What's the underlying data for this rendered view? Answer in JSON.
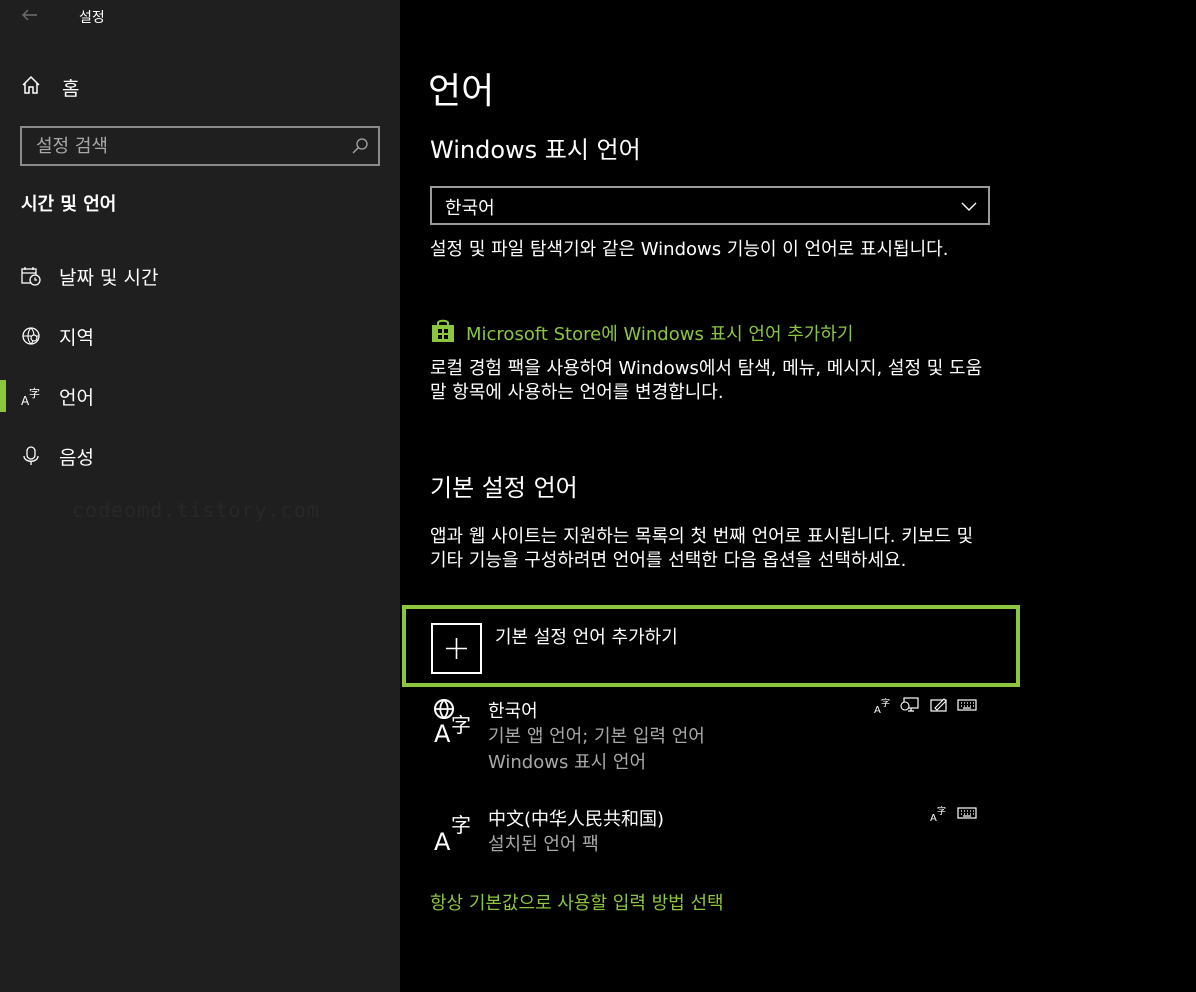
{
  "titlebar": {
    "app_title": "설정"
  },
  "sidebar": {
    "home_label": "홈",
    "search_placeholder": "설정 검색",
    "section_title": "시간 및 언어",
    "items": [
      {
        "label": "날짜 및 시간",
        "icon": "calendar-clock-icon"
      },
      {
        "label": "지역",
        "icon": "globe-region-icon"
      },
      {
        "label": "언어",
        "icon": "language-icon",
        "active": true
      },
      {
        "label": "음성",
        "icon": "microphone-icon"
      }
    ],
    "watermark": "codeomd.tistory.com"
  },
  "main": {
    "title": "언어",
    "display_lang": {
      "heading": "Windows 표시 언어",
      "selected": "한국어",
      "description": "설정 및 파일 탐색기와 같은 Windows 기능이 이 언어로 표시됩니다.",
      "store_link": "Microsoft Store에 Windows 표시 언어 추가하기",
      "store_desc": "로컬 경험 팩을 사용하여 Windows에서 탐색, 메뉴, 메시지, 설정 및 도움말 항목에 사용하는 언어를 변경합니다."
    },
    "preferred": {
      "heading": "기본 설정 언어",
      "description": "앱과 웹 사이트는 지원하는 목록의 첫 번째 언어로 표시됩니다. 키보드 및 기타 기능을 구성하려면 언어를 선택한 다음 옵션을 선택하세요.",
      "add_label": "기본 설정 언어 추가하기",
      "languages": [
        {
          "name": "한국어",
          "line1": "기본 앱 언어; 기본 입력 언어",
          "line2": "Windows 표시 언어"
        },
        {
          "name": "中文(中华人民共和国)",
          "line1": "설치된 언어 팩"
        }
      ]
    },
    "bottom_link": "항상 기본값으로 사용할 입력 방법 선택"
  },
  "colors": {
    "accent": "#8cc63f",
    "sidebar_bg": "#1f1f1f",
    "main_bg": "#000000",
    "secondary_text": "#a8a8a8"
  }
}
